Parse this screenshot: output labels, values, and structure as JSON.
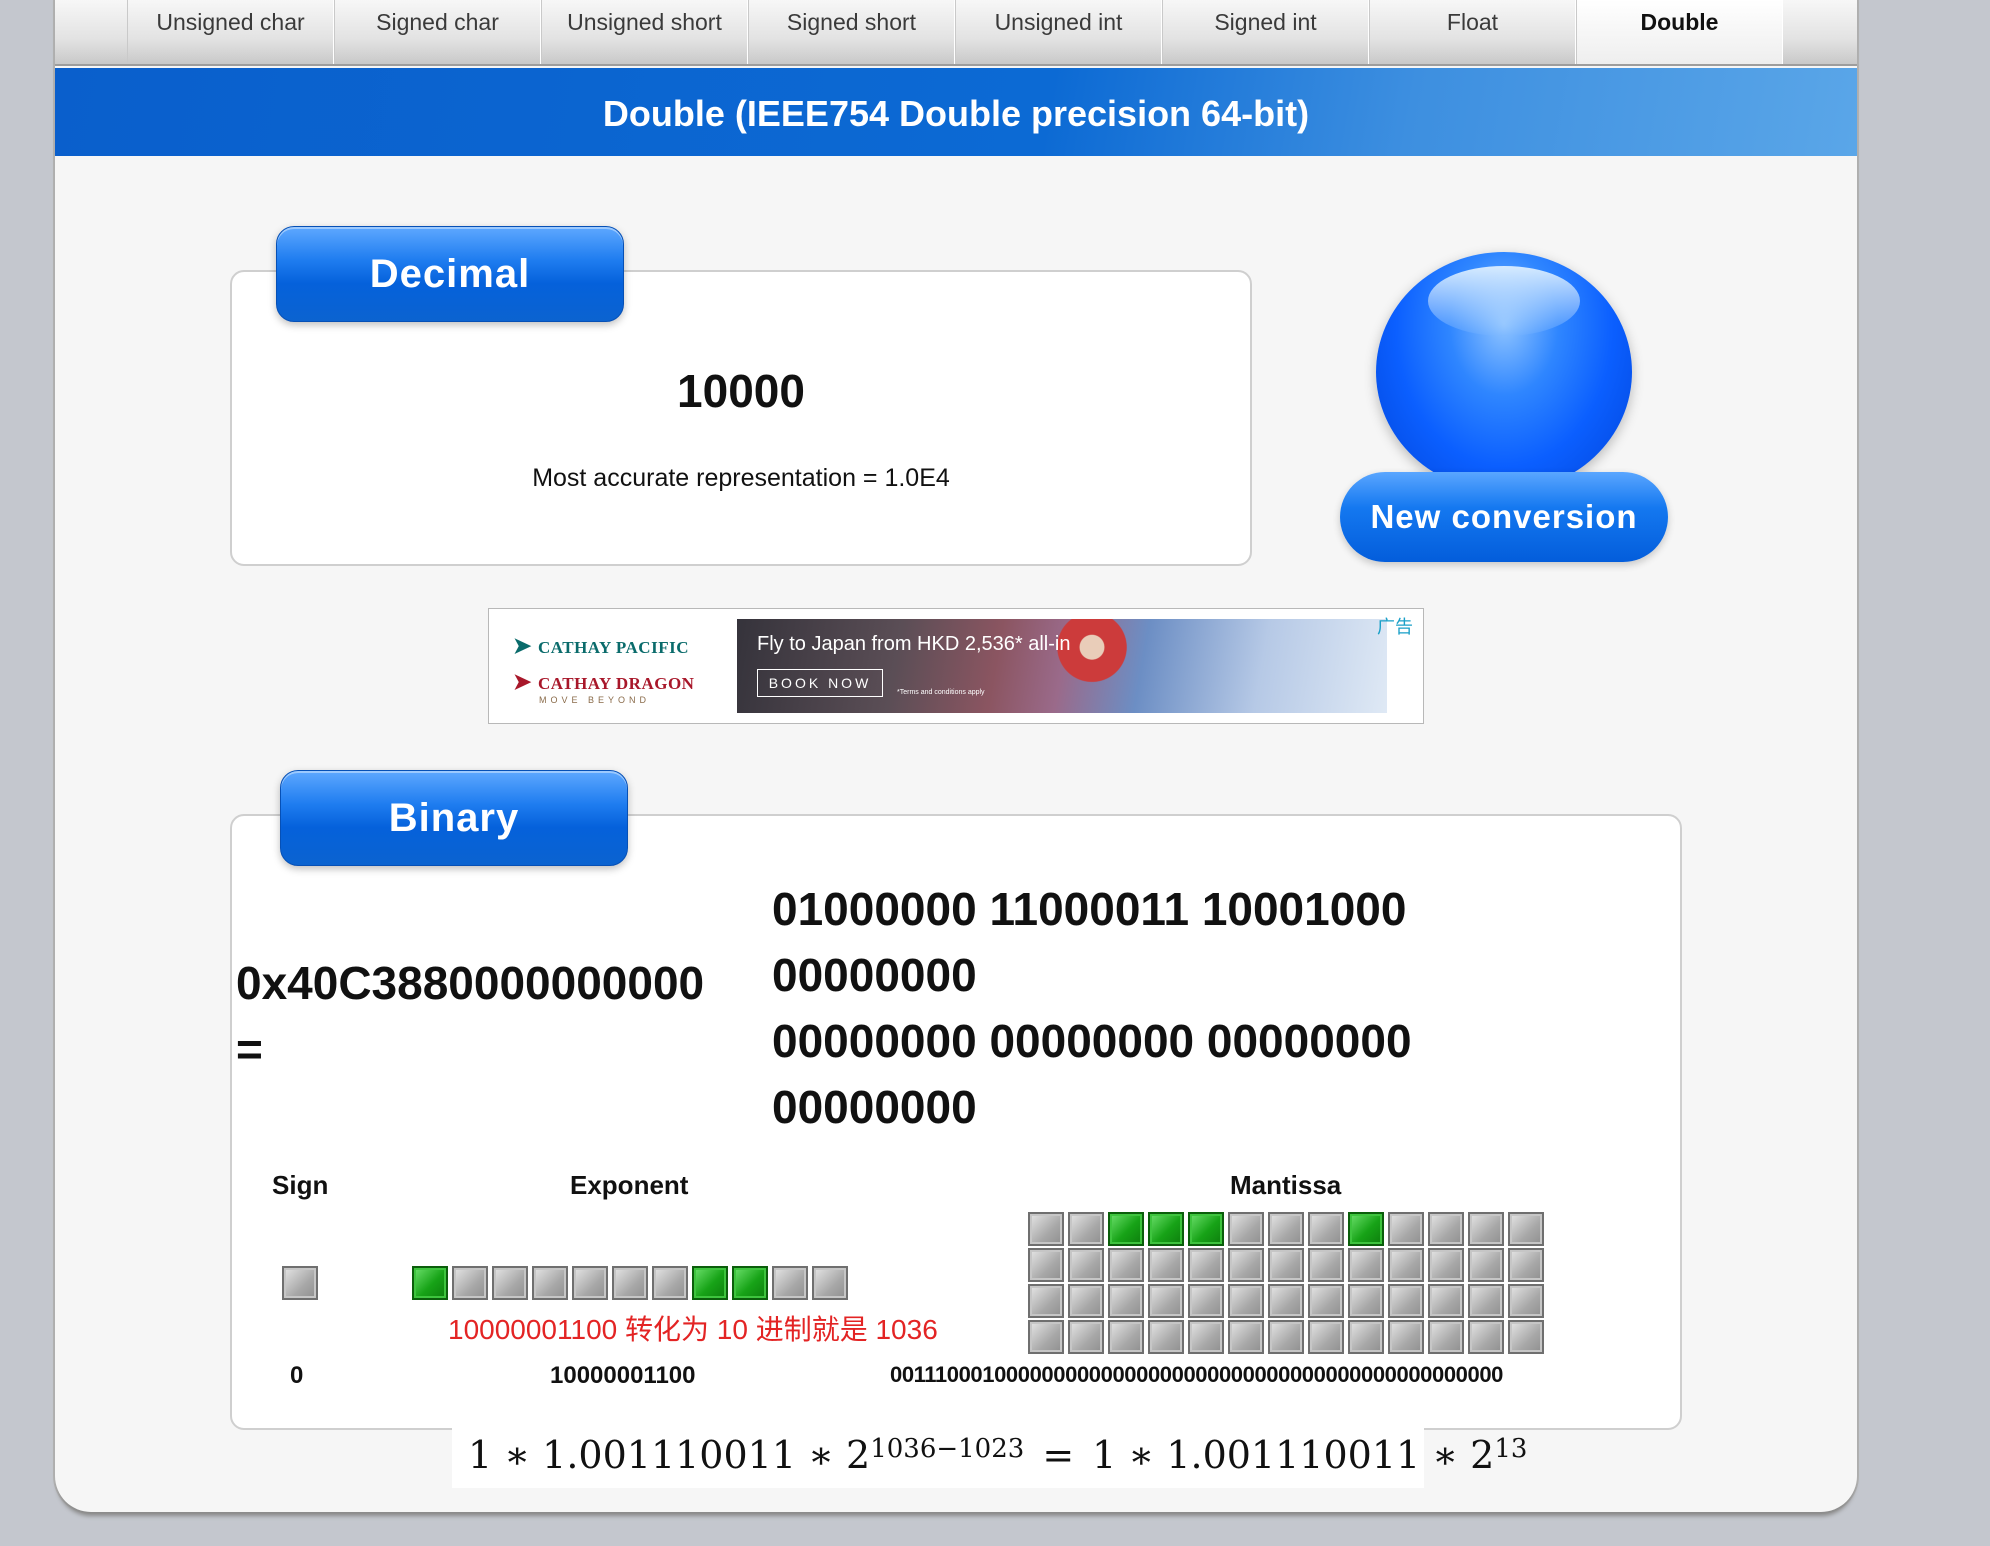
{
  "tabs": [
    {
      "label": "Unsigned char",
      "active": false
    },
    {
      "label": "Signed char",
      "active": false
    },
    {
      "label": "Unsigned short",
      "active": false
    },
    {
      "label": "Signed short",
      "active": false
    },
    {
      "label": "Unsigned int",
      "active": false
    },
    {
      "label": "Signed int",
      "active": false
    },
    {
      "label": "Float",
      "active": false
    },
    {
      "label": "Double",
      "active": true
    }
  ],
  "banner": {
    "title": "Double (IEEE754 Double precision 64-bit)"
  },
  "decimal": {
    "tab_label": "Decimal",
    "value": "10000",
    "accurate": "Most accurate representation = 1.0E4"
  },
  "new_conversion": {
    "label": "New conversion"
  },
  "ad": {
    "brand1": "CATHAY PACIFIC",
    "brand2": "CATHAY DRAGON",
    "tagline": "MOVE BEYOND",
    "headline": "Fly to Japan from HKD 2,536* all-in",
    "cta": "BOOK NOW",
    "terms": "*Terms and conditions apply",
    "label": "广告"
  },
  "binary": {
    "tab_label": "Binary",
    "hex": "0x40C3880000000000",
    "equals": "=",
    "lines": [
      "01000000 11000011 10001000",
      "00000000",
      "00000000 00000000 00000000",
      "00000000"
    ],
    "sign_label": "Sign",
    "exponent_label": "Exponent",
    "mantissa_label": "Mantissa",
    "sign_value": "0",
    "exponent_value": "10000001100",
    "mantissa_value": "0011100010000000000000000000000000000000000000000000",
    "sign_bits": [
      0
    ],
    "exponent_bits": [
      1,
      0,
      0,
      0,
      0,
      0,
      0,
      1,
      1,
      0,
      0
    ],
    "mantissa_bits": [
      0,
      0,
      1,
      1,
      1,
      0,
      0,
      0,
      1,
      0,
      0,
      0,
      0,
      0,
      0,
      0,
      0,
      0,
      0,
      0,
      0,
      0,
      0,
      0,
      0,
      0,
      0,
      0,
      0,
      0,
      0,
      0,
      0,
      0,
      0,
      0,
      0,
      0,
      0,
      0,
      0,
      0,
      0,
      0,
      0,
      0,
      0,
      0,
      0,
      0,
      0,
      0
    ],
    "note": "10000001100 转化为 10 进制就是 1036"
  },
  "formula": {
    "left": "1 ∗ 1.001110011 ∗ 2",
    "left_exp": "1036−1023",
    "eq": "=",
    "right": "1 ∗ 1.001110011 ∗ 2",
    "right_exp": "13"
  }
}
